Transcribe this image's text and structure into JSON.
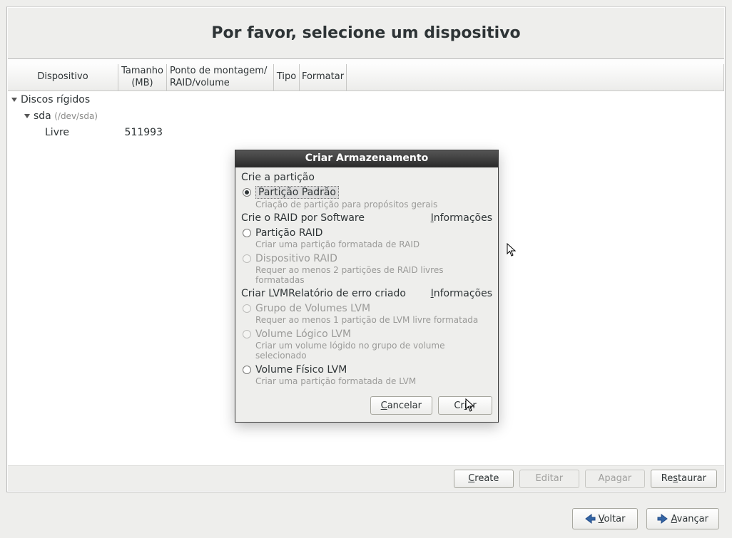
{
  "title": "Por favor, selecione um dispositivo",
  "columns": {
    "device": "Dispositivo",
    "size": "Tamanho\n(MB)",
    "mount": "Ponto de montagem/\nRAID/volume",
    "type": "Tipo",
    "format": "Formatar"
  },
  "tree": {
    "root": "Discos rígidos",
    "disk": "sda",
    "disk_path": "(/dev/sda)",
    "free_label": "Livre",
    "free_size": "511993"
  },
  "buttons": {
    "create": "Create",
    "edit": "Editar",
    "delete": "Apagar",
    "restore": "Restaurar",
    "back": "Voltar",
    "next": "Avançar"
  },
  "modal": {
    "title": "Criar Armazenamento",
    "sect_partition": "Crie a partição",
    "sect_raid": "Crie o RAID por Software",
    "sect_lvm": "Criar LVMRelatório de erro criado",
    "info": "Informações",
    "opts": {
      "std": {
        "label": "Partição Padrão",
        "desc": "Criação de partição para propósitos gerais"
      },
      "raid_part": {
        "label": "Partição RAID",
        "desc": "Criar uma partição formatada de RAID"
      },
      "raid_dev": {
        "label": "Dispositivo RAID",
        "desc": "Requer ao menos 2 partições de RAID livres formatadas"
      },
      "lvm_vg": {
        "label": "Grupo de Volumes LVM",
        "desc": "Requer ao menos 1 partição de LVM livre formatada"
      },
      "lvm_lv": {
        "label": "Volume Lógico LVM",
        "desc": "Criar um volume lógido no grupo de volume selecionado"
      },
      "lvm_pv": {
        "label": "Volume Físico LVM",
        "desc": "Criar uma partição formatada de LVM"
      }
    },
    "cancel": "Cancelar",
    "create": "Criar"
  }
}
